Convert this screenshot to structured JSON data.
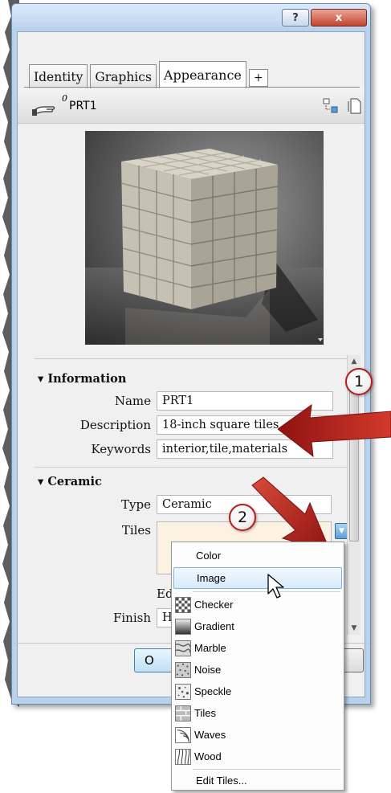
{
  "window": {
    "help_button": "?",
    "close_button": "x"
  },
  "tabs": [
    {
      "label": "Identity"
    },
    {
      "label": "Graphics"
    },
    {
      "label": "Appearance"
    }
  ],
  "tab_add_label": "+",
  "header": {
    "user_count": "0",
    "material_name": "PRT1"
  },
  "information": {
    "title": "Information",
    "name_label": "Name",
    "name_value": "PRT1",
    "description_label": "Description",
    "description_value": "18-inch square tiles",
    "keywords_label": "Keywords",
    "keywords_value": "interior,tile,materials"
  },
  "ceramic": {
    "title": "Ceramic",
    "type_label": "Type",
    "type_value": "Ceramic",
    "tiles_label": "Tiles",
    "edit_label": "Edit.",
    "finish_label": "Finish",
    "finish_value": "Hig"
  },
  "ok_button": "O",
  "callouts": [
    "1",
    "2"
  ],
  "menu": {
    "items": [
      {
        "label": "Color",
        "icon": "none"
      },
      {
        "label": "Image",
        "icon": "none",
        "highlighted": true
      },
      {
        "label": "Checker",
        "icon": "checker-icon"
      },
      {
        "label": "Gradient",
        "icon": "gradient-icon"
      },
      {
        "label": "Marble",
        "icon": "marble-icon"
      },
      {
        "label": "Noise",
        "icon": "noise-icon"
      },
      {
        "label": "Speckle",
        "icon": "speckle-icon"
      },
      {
        "label": "Tiles",
        "icon": "tiles-icon"
      },
      {
        "label": "Waves",
        "icon": "waves-icon"
      },
      {
        "label": "Wood",
        "icon": "wood-icon"
      },
      {
        "label": "Edit Tiles...",
        "icon": "none"
      }
    ]
  },
  "colors": {
    "callout_border": "#b71c1c",
    "arrow_red": "#c62828",
    "menu_highlight": "#d6ebfa",
    "tile_swatch": "#fbf2e4"
  }
}
